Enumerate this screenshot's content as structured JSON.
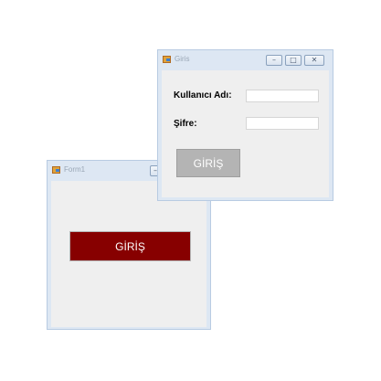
{
  "form1": {
    "title": "Form1",
    "minimize_glyph": "–",
    "button_label": "GİRİŞ",
    "button_color": "#870000"
  },
  "giris": {
    "title": "Giris",
    "controls": {
      "minimize": "–",
      "maximize": "□",
      "close": "✕"
    },
    "username_label": "Kullanıcı Adı:",
    "username_value": "",
    "password_label": "Şifre:",
    "password_value": "",
    "button_label": "GİRİŞ",
    "button_color": "#b4b4b4"
  },
  "colors": {
    "window_frame": "#dde7f3",
    "client_area": "#efefef"
  }
}
